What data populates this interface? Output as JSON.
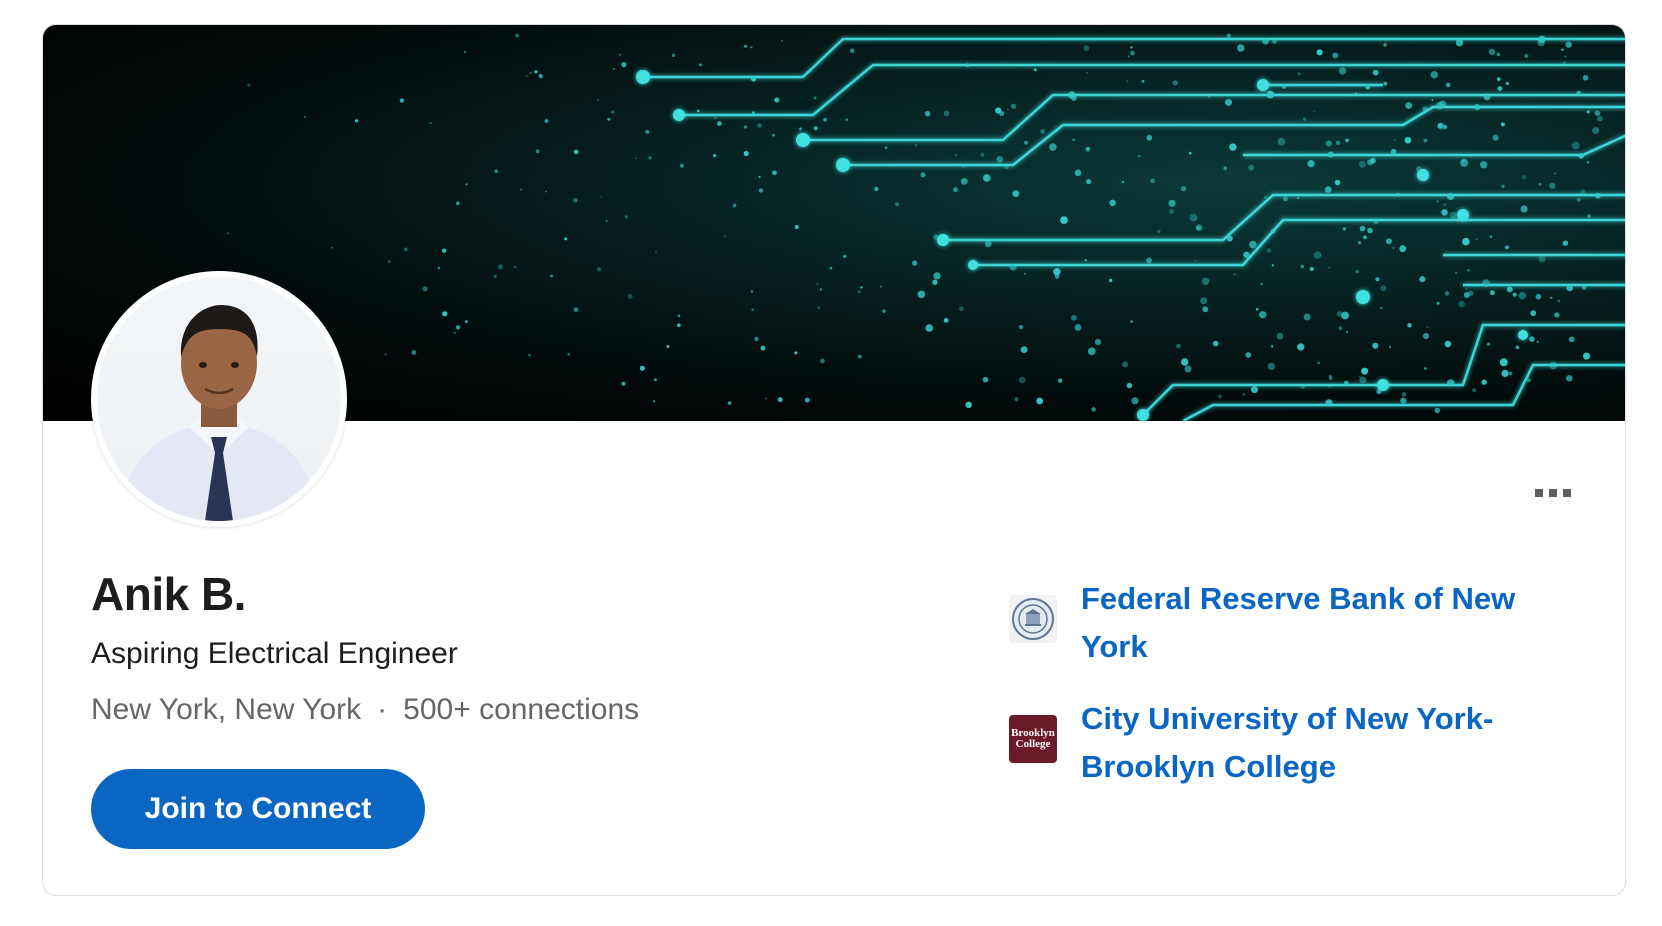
{
  "profile": {
    "name": "Anik B.",
    "headline": "Aspiring Electrical Engineer",
    "location": "New York, New York",
    "separator": "·",
    "connections": "500+ connections",
    "join_button_label": "Join to Connect"
  },
  "organizations": [
    {
      "name": "Federal Reserve Bank of New York",
      "logo": "frb-seal-icon"
    },
    {
      "name": "City University of New York-Brooklyn College",
      "logo": "brooklyn-college-logo",
      "logo_text": "Brooklyn College"
    }
  ],
  "colors": {
    "accent": "#0a66c2",
    "banner_glow": "#3fe0e0",
    "brooklyn_college": "#6b1a2a"
  },
  "icons": {
    "more": "more-horizontal-icon"
  }
}
